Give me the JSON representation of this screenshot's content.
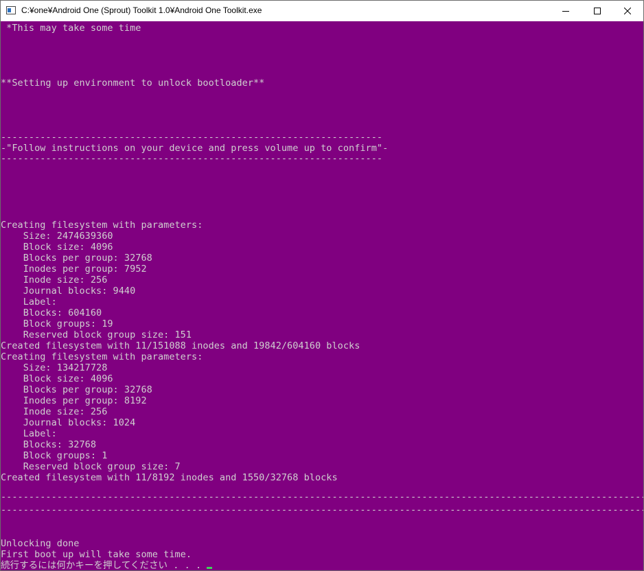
{
  "window": {
    "title": "C:¥one¥Android One (Sprout) Toolkit 1.0¥Android One Toolkit.exe"
  },
  "console": {
    "lines": [
      " *This may take some time",
      "**Setting up environment to unlock bootloader**",
      "--------------------------------------------------------------------",
      "-\"Follow instructions on your device and press volume up to confirm\"-",
      "--------------------------------------------------------------------",
      "Creating filesystem with parameters:",
      "    Size: 2474639360",
      "    Block size: 4096",
      "    Blocks per group: 32768",
      "    Inodes per group: 7952",
      "    Inode size: 256",
      "    Journal blocks: 9440",
      "    Label:",
      "    Blocks: 604160",
      "    Block groups: 19",
      "    Reserved block group size: 151",
      "Created filesystem with 11/151088 inodes and 19842/604160 blocks",
      "Creating filesystem with parameters:",
      "    Size: 134217728",
      "    Block size: 4096",
      "    Blocks per group: 32768",
      "    Inodes per group: 8192",
      "    Inode size: 256",
      "    Journal blocks: 1024",
      "    Label:",
      "    Blocks: 32768",
      "    Block groups: 1",
      "    Reserved block group size: 7",
      "Created filesystem with 11/8192 inodes and 1550/32768 blocks",
      "-------------------------------------------------------------------------------------------------------------------------",
      "-------------------------------------------------------------------------------------------------------------------------",
      "Unlocking done",
      "First boot up will take some time.",
      "続行するには何かキーを押してください . . . "
    ]
  },
  "colors": {
    "background": "#800080",
    "text": "#d0d0d0",
    "cursor": "#3fd15a"
  }
}
